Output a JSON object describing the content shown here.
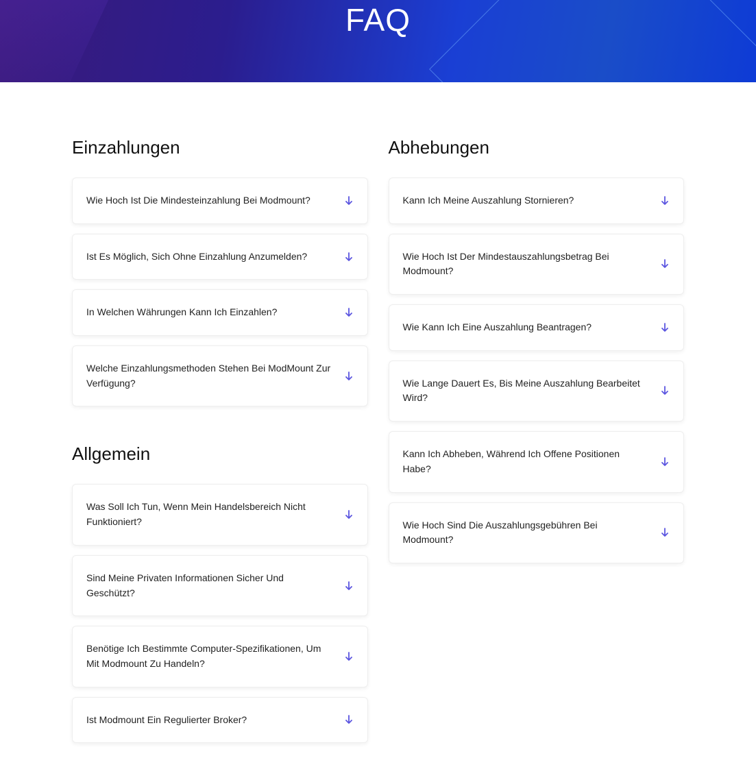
{
  "hero": {
    "title": "FAQ"
  },
  "sections": {
    "deposits": {
      "title": "Einzahlungen",
      "items": [
        {
          "q": "Wie Hoch Ist Die Mindesteinzahlung Bei Modmount?"
        },
        {
          "q": "Ist Es Möglich, Sich Ohne Einzahlung Anzumelden?"
        },
        {
          "q": "In Welchen Währungen Kann Ich Einzahlen?"
        },
        {
          "q": "Welche Einzahlungsmethoden Stehen Bei ModMount Zur Verfügung?"
        }
      ]
    },
    "general": {
      "title": "Allgemein",
      "items": [
        {
          "q": "Was Soll Ich Tun, Wenn Mein Handelsbereich Nicht Funktioniert?"
        },
        {
          "q": "Sind Meine Privaten Informationen Sicher Und Geschützt?"
        },
        {
          "q": "Benötige Ich Bestimmte Computer-Spezifikationen, Um Mit Modmount Zu Handeln?"
        },
        {
          "q": "Ist Modmount Ein Regulierter Broker?"
        }
      ]
    },
    "withdrawals": {
      "title": "Abhebungen",
      "items": [
        {
          "q": "Kann Ich Meine Auszahlung Stornieren?"
        },
        {
          "q": "Wie Hoch Ist Der Mindestauszahlungsbetrag Bei Modmount?"
        },
        {
          "q": "Wie Kann Ich Eine Auszahlung Beantragen?"
        },
        {
          "q": "Wie Lange Dauert Es, Bis Meine Auszahlung Bearbeitet Wird?"
        },
        {
          "q": "Kann Ich Abheben, Während Ich Offene Positionen Habe?"
        },
        {
          "q": "Wie Hoch Sind Die Auszahlungsgebühren Bei Modmount?"
        }
      ]
    }
  }
}
